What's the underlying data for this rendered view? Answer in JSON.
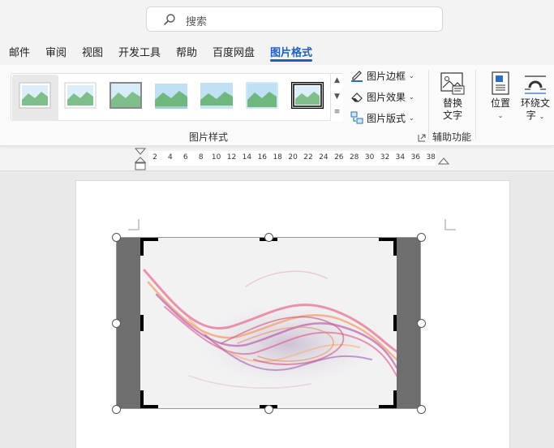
{
  "search": {
    "placeholder": "搜索"
  },
  "tabs": [
    {
      "label": "邮件",
      "active": false
    },
    {
      "label": "审阅",
      "active": false
    },
    {
      "label": "视图",
      "active": false
    },
    {
      "label": "开发工具",
      "active": false
    },
    {
      "label": "帮助",
      "active": false
    },
    {
      "label": "百度网盘",
      "active": false
    },
    {
      "label": "图片格式",
      "active": true
    }
  ],
  "ribbon": {
    "picture_styles_group": "图片样式",
    "accessibility_group": "辅助功能",
    "border_label": "图片边框",
    "effects_label": "图片效果",
    "layout_label": "图片版式",
    "alt_text_line1": "替换",
    "alt_text_line2": "文字",
    "position_label": "位置",
    "wrap_text_line1": "环绕文",
    "wrap_text_line2": "字"
  },
  "ruler": {
    "marks": [
      "2",
      "4",
      "6",
      "8",
      "10",
      "12",
      "14",
      "16",
      "18",
      "20",
      "22",
      "24",
      "26",
      "28",
      "30",
      "32",
      "34",
      "36",
      "38"
    ]
  },
  "colors": {
    "accent": "#1f5fbf",
    "crop_band": "#6e6e6e"
  }
}
